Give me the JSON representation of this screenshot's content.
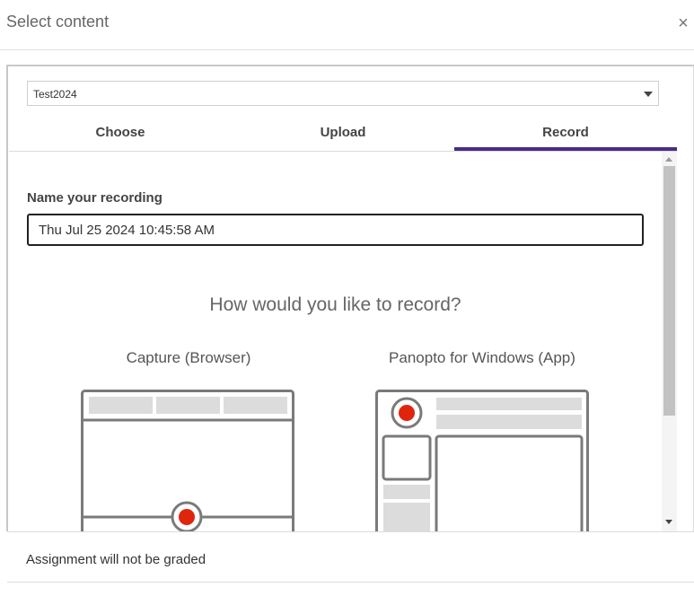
{
  "dialog": {
    "title": "Select content",
    "close_label": "×"
  },
  "folder_select": {
    "value": "Test2024"
  },
  "tabs": [
    {
      "label": "Choose",
      "active": false
    },
    {
      "label": "Upload",
      "active": false
    },
    {
      "label": "Record",
      "active": true
    }
  ],
  "accent_color": "#4b2c87",
  "record": {
    "name_label": "Name your recording",
    "name_value": "Thu Jul 25 2024 10:45:58 AM",
    "question": "How would you like to record?",
    "options": [
      {
        "title": "Capture (Browser)",
        "icon": "browser-recorder-illustration"
      },
      {
        "title": "Panopto for Windows (App)",
        "icon": "windows-app-illustration"
      }
    ]
  },
  "footer": {
    "text": "Assignment will not be graded"
  }
}
